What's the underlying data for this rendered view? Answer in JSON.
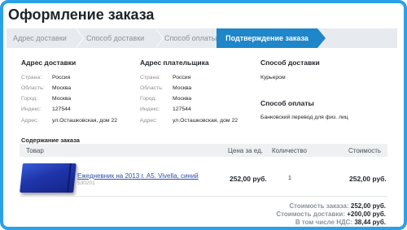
{
  "page": {
    "title": "Оформление заказа"
  },
  "steps": {
    "items": [
      "Адрес доставки",
      "Способ доставки",
      "Способ оплаты"
    ],
    "active": "Подтверждение заказа"
  },
  "delivery_address": {
    "heading": "Адрес доставки",
    "rows": [
      {
        "label": "Страна:",
        "value": "Россия"
      },
      {
        "label": "Область:",
        "value": "Москва"
      },
      {
        "label": "Город:",
        "value": "Москва"
      },
      {
        "label": "Индекс:",
        "value": "127544"
      },
      {
        "label": "Адрес:",
        "value": "ул.Осташковская, дом 22"
      }
    ]
  },
  "payer_address": {
    "heading": "Адрес плательщика",
    "rows": [
      {
        "label": "Страна:",
        "value": "Россия"
      },
      {
        "label": "Область:",
        "value": "Москва"
      },
      {
        "label": "Город:",
        "value": "Москва"
      },
      {
        "label": "Индекс:",
        "value": "127544"
      },
      {
        "label": "Адрес:",
        "value": "ул.Осташковская, дом 22"
      }
    ]
  },
  "shipping": {
    "heading": "Способ доставки",
    "value": "Курьером"
  },
  "payment": {
    "heading": "Способ оплаты",
    "value": "Банковский перевод для физ. лиц"
  },
  "order": {
    "title": "Содержание заказа",
    "columns": {
      "product": "Товар",
      "unit_price": "Цена за ед.",
      "quantity": "Количество",
      "cost": "Стоимость"
    },
    "items": [
      {
        "name": "Ежедневник на 2013 г. А5. Vivella, синий",
        "code": "530201",
        "unit_price": "252,00 руб.",
        "quantity": "1",
        "cost": "252,00 руб."
      }
    ]
  },
  "totals": {
    "order_label": "Стоимость заказа:",
    "order_value": "252,00 руб.",
    "delivery_label": "Стоимость доставки:",
    "delivery_value": "+200,00 руб.",
    "vat_label": "В том числе НДС:",
    "vat_value": "38,44 руб."
  }
}
